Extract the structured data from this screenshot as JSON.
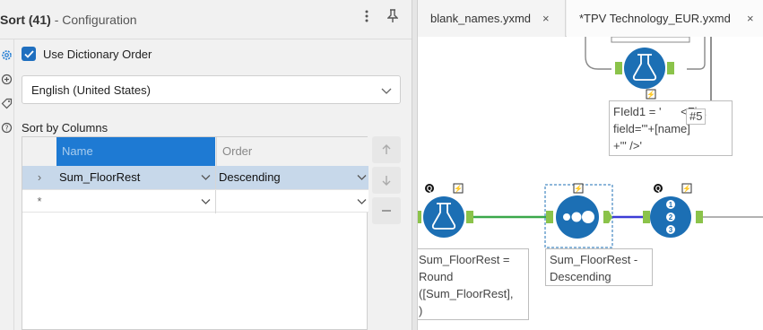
{
  "panel": {
    "title": "Sort (41)",
    "subtitle": "- Configuration",
    "more_icon": "vertical-ellipsis-icon",
    "pin_icon": "pin-icon",
    "use_dictionary_label": "Use Dictionary Order",
    "use_dictionary_checked": true,
    "language": "English (United States)",
    "sort_by_label": "Sort by Columns",
    "columns": {
      "name": "Name",
      "order": "Order"
    },
    "rows": [
      {
        "marker": "›",
        "name": "Sum_FloorRest",
        "order": "Descending"
      },
      {
        "marker": "*",
        "name": "",
        "order": ""
      }
    ],
    "side_icons": [
      "gear-icon",
      "settings-alt-icon",
      "tag-icon",
      "help-icon"
    ],
    "buttons": [
      "move-up-icon",
      "move-down-icon",
      "remove-icon"
    ]
  },
  "tabs": [
    {
      "label": "blank_names.yxmd",
      "close": "×"
    },
    {
      "label": "*TPV Technology_EUR.yxmd",
      "close": "×"
    }
  ],
  "canvas": {
    "top_annotation": "FIeld1 = '      <Fi...\nfield=\"'+[name]\n+'\" />'",
    "tag_label": "#5",
    "formula_annotation": "Sum_FloorRest =\nRound\n([Sum_FloorRest],\n)",
    "sort_annotation": "Sum_FloorRest -\nDescending",
    "badge_q": "Q",
    "badge_bolt": "⚡",
    "record_id_digits": [
      "1",
      "2",
      "3"
    ]
  },
  "colors": {
    "accent": "#1e7ad3",
    "tool_blue": "#1c6fb4",
    "connection_green": "#3aa84a",
    "connection_blue": "#3c3cd6",
    "anchor_green": "#8bc34a"
  }
}
